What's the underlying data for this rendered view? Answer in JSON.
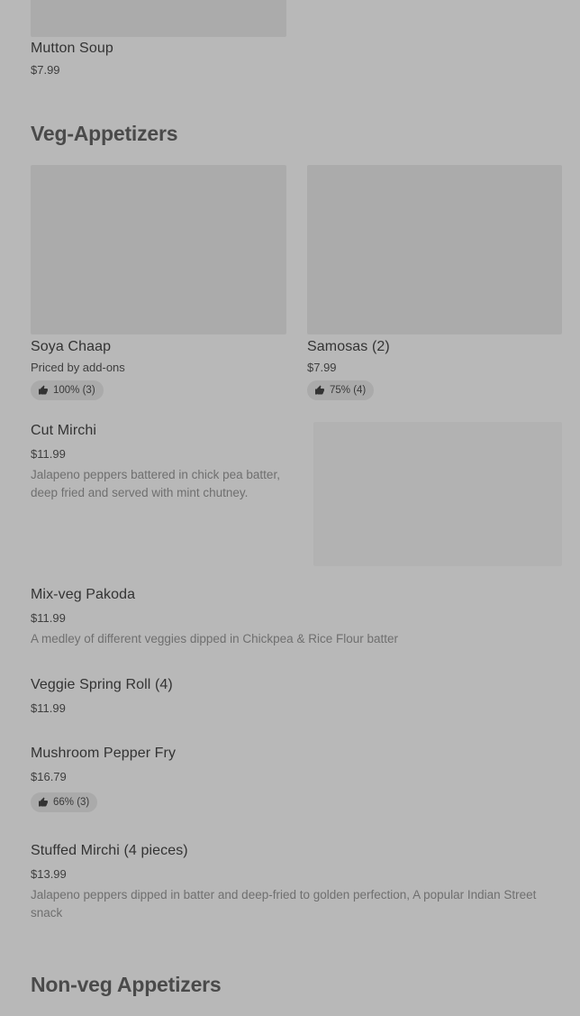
{
  "prev_section": {
    "items": [
      {
        "name": "Mutton Soup",
        "price": "$7.99"
      }
    ]
  },
  "veg_appetizers": {
    "title": "Veg-Appetizers",
    "featured": [
      {
        "name": "Soya Chaap",
        "price": "Priced by add-ons",
        "rating": "100% (3)"
      },
      {
        "name": "Samosas (2)",
        "price": "$7.99",
        "rating": "75% (4)"
      }
    ],
    "items": [
      {
        "name": "Cut Mirchi",
        "price": "$11.99",
        "description": "Jalapeno peppers battered in chick pea batter, deep fried and served with mint chutney."
      },
      {
        "name": "Mix-veg Pakoda",
        "price": "$11.99",
        "description": "A medley of different veggies dipped in Chickpea & Rice Flour batter"
      },
      {
        "name": "Veggie Spring Roll (4)",
        "price": "$11.99"
      },
      {
        "name": "Mushroom Pepper Fry",
        "price": "$16.79",
        "rating": "66% (3)"
      },
      {
        "name": "Stuffed Mirchi (4 pieces)",
        "price": "$13.99",
        "description": "Jalapeno peppers dipped in batter and deep-fried to golden perfection, A popular Indian Street snack"
      }
    ]
  },
  "non_veg_appetizers": {
    "title": "Non-veg Appetizers"
  },
  "icons": {
    "rating": "thumbs-up-icon"
  }
}
